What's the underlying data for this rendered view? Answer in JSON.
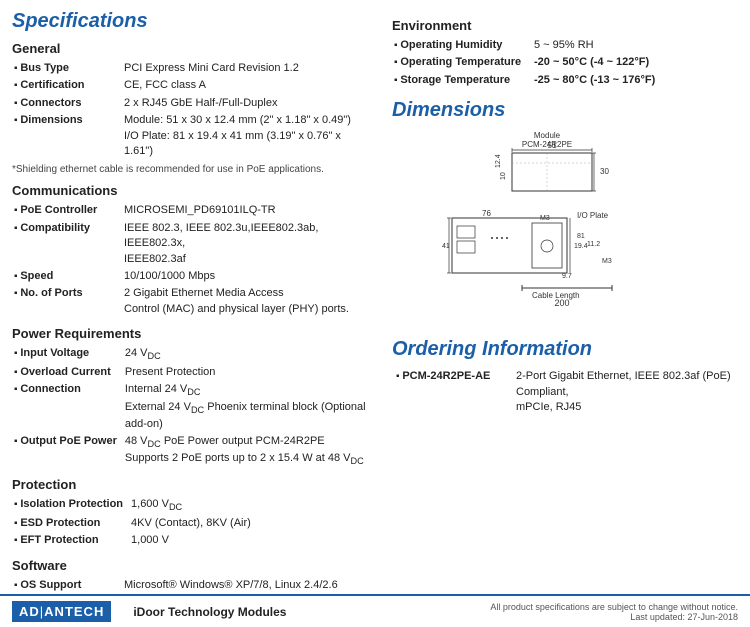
{
  "page": {
    "title": "Specifications"
  },
  "left": {
    "sections": [
      {
        "id": "general",
        "title": "General",
        "rows": [
          {
            "label": "Bus Type",
            "value": "PCI Express Mini Card Revision 1.2"
          },
          {
            "label": "Certification",
            "value": "CE, FCC class A"
          },
          {
            "label": "Connectors",
            "value": "2 x RJ45 GbE Half-/Full-Duplex"
          },
          {
            "label": "Dimensions",
            "value": "Module: 51 x 30 x 12.4 mm (2\" x 1.18\" x 0.49\")\nI/O Plate: 81 x 19.4 x 41 mm (3.19\" x 0.76\" x 1.61\")"
          }
        ]
      },
      {
        "id": "shielding-note",
        "note": "*Shielding ethernet cable is recommended for use in PoE applications."
      },
      {
        "id": "communications",
        "title": "Communications",
        "rows": [
          {
            "label": "PoE Controller",
            "value": "MICROSEMI_PD69101ILQ-TR"
          },
          {
            "label": "Compatibility",
            "value": "IEEE 802.3, IEEE 802.3u,IEEE802.3ab, IEEE802.3x,\nIEEE802.3af"
          },
          {
            "label": "Speed",
            "value": "10/100/1000 Mbps"
          },
          {
            "label": "No. of Ports",
            "value": "2 Gigabit Ethernet Media Access\nControl (MAC) and physical layer (PHY) ports."
          }
        ]
      },
      {
        "id": "power",
        "title": "Power Requirements",
        "rows": [
          {
            "label": "Input Voltage",
            "value": "24 VDC"
          },
          {
            "label": "Overload Current",
            "value": "Present Protection"
          },
          {
            "label": "Connection",
            "value": "Internal 24 VDC\nExternal 24 VDC Phoenix terminal block (Optional\nadd-on)"
          },
          {
            "label": "Output PoE Power",
            "value": "48 VDC PoE Power output PCM-24R2PE\nSupports 2 PoE ports up to 2 x 15.4 W at 48 VDC"
          }
        ]
      },
      {
        "id": "protection",
        "title": "Protection",
        "rows": [
          {
            "label": "Isolation Protection",
            "value": "1,600 VDC"
          },
          {
            "label": "ESD Protection",
            "value": "4KV (Contact), 8KV (Air)"
          },
          {
            "label": "EFT Protection",
            "value": "1,000 V"
          }
        ]
      },
      {
        "id": "software",
        "title": "Software",
        "rows": [
          {
            "label": "OS Support",
            "value": "Microsoft® Windows® XP/7/8, Linux 2.4/2.6"
          }
        ]
      }
    ]
  },
  "right": {
    "environment": {
      "title": "Environment",
      "rows": [
        {
          "label": "Operating Humidity",
          "value": "5 ~ 95% RH"
        },
        {
          "label": "Operating Temperature",
          "value": "-20 ~ 50°C (-4 ~ 122°F)"
        },
        {
          "label": "Storage Temperature",
          "value": "-25 ~ 80°C (-13 ~ 176°F)"
        }
      ]
    },
    "dimensions": {
      "title": "Dimensions"
    },
    "ordering": {
      "title": "Ordering Information",
      "rows": [
        {
          "label": "PCM-24R2PE-AE",
          "value": "2-Port Gigabit Ethernet, IEEE 802.3af (PoE) Compliant, mPCIe, RJ45"
        }
      ]
    }
  },
  "footer": {
    "logo_text": "AD/ANTECH",
    "tagline": "iDoor Technology Modules",
    "note": "All product specifications are subject to change without notice.",
    "date": "Last updated: 27-Jun-2018"
  }
}
